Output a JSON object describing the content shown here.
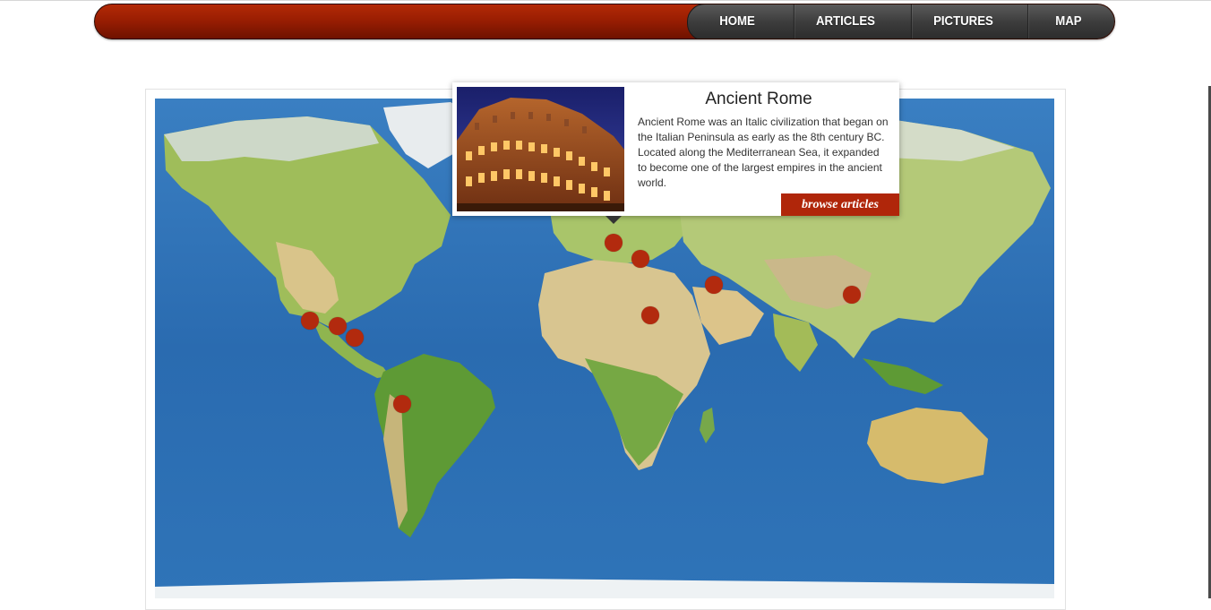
{
  "nav": {
    "items": [
      {
        "label": "HOME"
      },
      {
        "label": "ARTICLES"
      },
      {
        "label": "PICTURES"
      },
      {
        "label": "MAP"
      }
    ]
  },
  "popup": {
    "title": "Ancient Rome",
    "description": "Ancient Rome was an Italic civilization that began on the Italian Peninsula as early as the 8th century BC. Located along the Mediterranean Sea, it expanded to become one of the largest empires in the ancient world.",
    "button_label": "browse articles",
    "image": "colosseum-photo"
  },
  "map": {
    "type": "world-physical",
    "marker_count": 10
  },
  "colors": {
    "brand_red": "#9a1e02",
    "marker": "#b22a0e",
    "nav_dark": "#3c3c3c",
    "ocean": "#2d6fb3"
  }
}
